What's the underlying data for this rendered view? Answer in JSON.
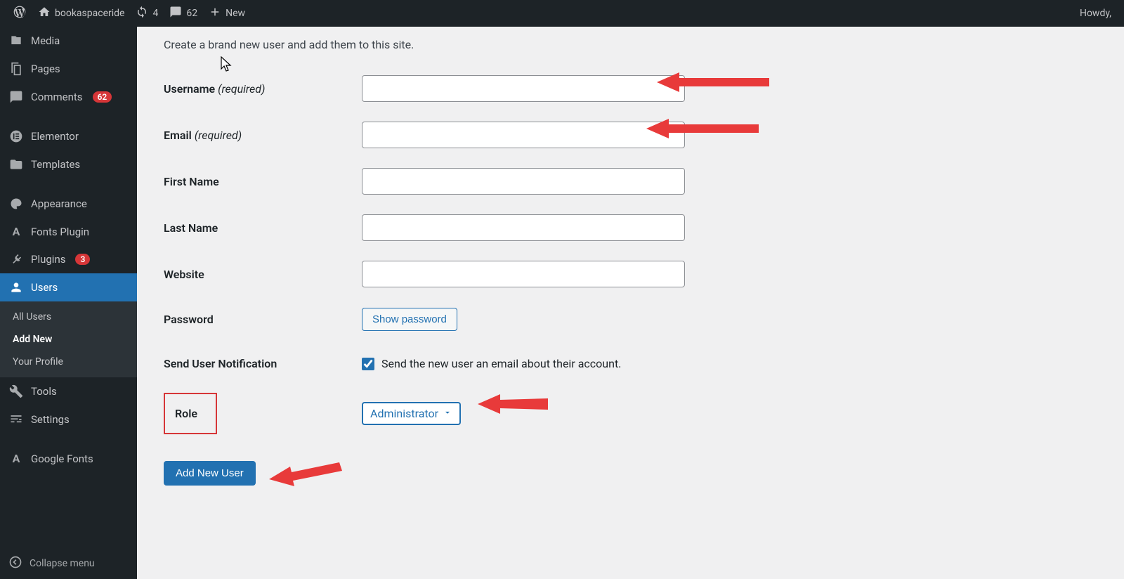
{
  "adminbar": {
    "site_name": "bookaspaceride",
    "updates": "4",
    "comments": "62",
    "new_label": "New",
    "howdy": "Howdy,"
  },
  "sidebar": {
    "media": "Media",
    "pages": "Pages",
    "comments": "Comments",
    "comments_count": "62",
    "elementor": "Elementor",
    "templates": "Templates",
    "appearance": "Appearance",
    "fonts_plugin": "Fonts Plugin",
    "plugins": "Plugins",
    "plugins_count": "3",
    "users": "Users",
    "tools": "Tools",
    "settings": "Settings",
    "google_fonts": "Google Fonts",
    "collapse": "Collapse menu",
    "submenu": {
      "all_users": "All Users",
      "add_new": "Add New",
      "your_profile": "Your Profile"
    }
  },
  "page": {
    "description": "Create a brand new user and add them to this site."
  },
  "form": {
    "username_label": "Username",
    "email_label": "Email",
    "first_name_label": "First Name",
    "last_name_label": "Last Name",
    "website_label": "Website",
    "password_label": "Password",
    "show_password": "Show password",
    "send_notification_label": "Send User Notification",
    "send_notification_desc": "Send the new user an email about their account.",
    "send_notification_checked": true,
    "role_label": "Role",
    "role_value": "Administrator",
    "required": "(required)",
    "submit": "Add New User"
  }
}
